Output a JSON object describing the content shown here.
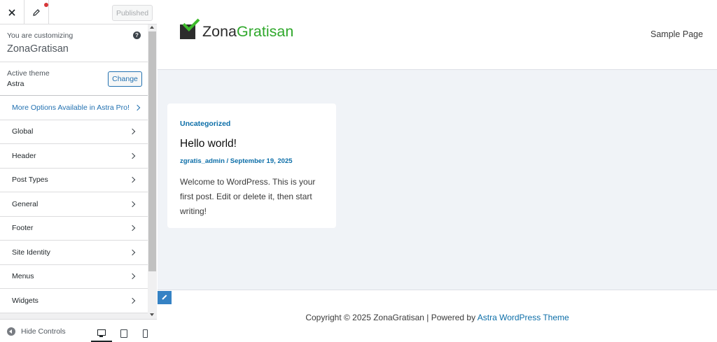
{
  "customizer": {
    "publish_label": "Published",
    "info_label": "You are customizing",
    "site_title": "ZonaGratisan",
    "help_glyph": "?",
    "theme_label": "Active theme",
    "theme_name": "Astra",
    "change_label": "Change",
    "pro_label": "More Options Available in Astra Pro!",
    "items": [
      {
        "label": "Global"
      },
      {
        "label": "Header"
      },
      {
        "label": "Post Types"
      },
      {
        "label": "General"
      },
      {
        "label": "Footer"
      },
      {
        "label": "Site Identity"
      },
      {
        "label": "Menus"
      },
      {
        "label": "Widgets"
      }
    ],
    "hide_controls_label": "Hide Controls",
    "devices": [
      {
        "name": "desktop",
        "active": true
      },
      {
        "name": "tablet",
        "active": false
      },
      {
        "name": "mobile",
        "active": false
      }
    ],
    "icons": [
      "close-icon",
      "pencil-icon",
      "help-icon",
      "chevron-right-icon",
      "arrow-left-icon",
      "desktop-icon",
      "tablet-icon",
      "mobile-icon"
    ]
  },
  "preview": {
    "logo_part1": "Zona",
    "logo_part2": "Gratisan",
    "nav_link": "Sample Page",
    "post": {
      "category": "Uncategorized",
      "title": "Hello world!",
      "meta": "zgratis_admin / September 19, 2025",
      "excerpt": "Welcome to WordPress. This is your first post. Edit or delete it, then start writing!"
    },
    "footer_text": "Copyright © 2025 ZonaGratisan | Powered by ",
    "footer_link": "Astra WordPress Theme"
  },
  "colors": {
    "accent": "#2271b1",
    "link": "#0c6ea8",
    "logo_green": "#2fa82b",
    "notification": "#d63638"
  }
}
